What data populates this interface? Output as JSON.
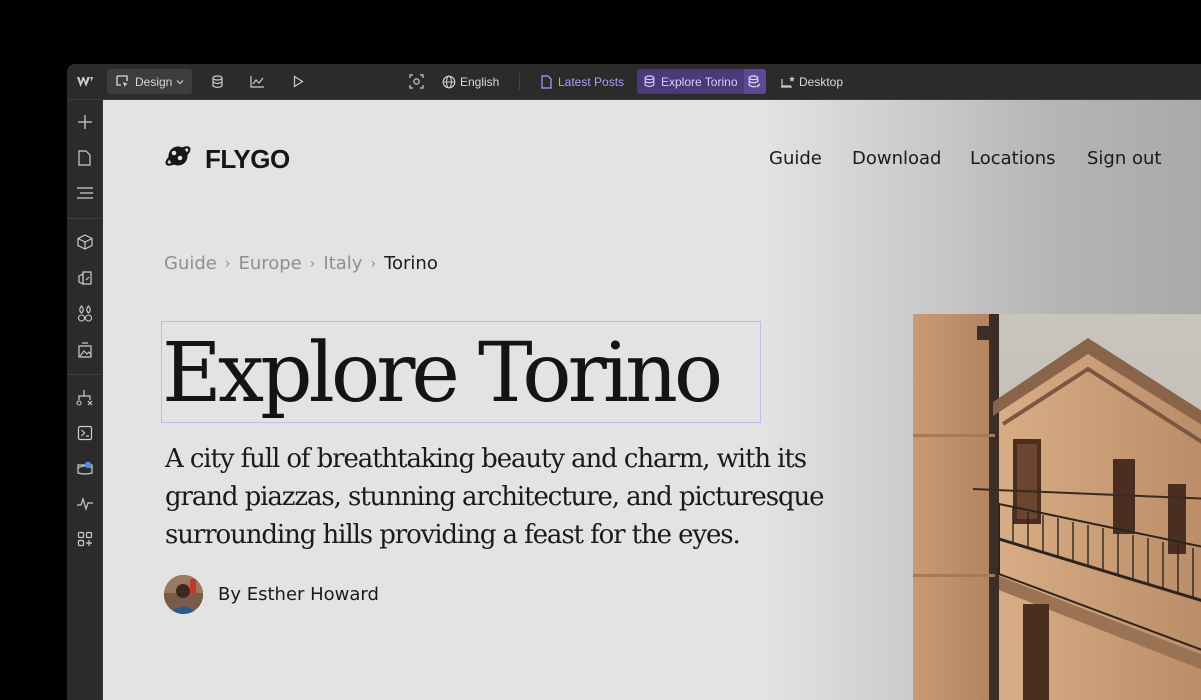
{
  "toolbar": {
    "mode_label": "Design",
    "locale_label": "English",
    "page_label": "Latest Posts",
    "collection_label": "Explore Torino",
    "breakpoint_label": "Desktop"
  },
  "site": {
    "brand": "FLYGO",
    "nav": [
      "Guide",
      "Download",
      "Locations",
      "Sign out"
    ],
    "breadcrumb": [
      "Guide",
      "Europe",
      "Italy",
      "Torino"
    ],
    "title": "Explore Torino",
    "description": "A city full of breathtaking beauty and charm, with its grand piazzas, stunning architecture, and picturesque surrounding hills providing a feast for the eyes.",
    "author": "By Esther Howard"
  },
  "breadcrumb_separator": "›",
  "icons": {
    "toolbar": [
      "webflow-logo-icon",
      "cursor-box-icon",
      "chevron-down-icon",
      "database-icon",
      "chart-icon",
      "play-icon",
      "preview-icon",
      "globe-icon",
      "page-icon",
      "collection-icon",
      "cms-icon",
      "desktop-icon"
    ],
    "sidebar": [
      "plus-icon",
      "pages-icon",
      "navigator-icon",
      "components-icon",
      "variables-icon",
      "style-icon",
      "assets-icon",
      "logic-icon",
      "code-icon",
      "apps-icon",
      "activity-icon",
      "marketplace-icon"
    ]
  },
  "colors": {
    "toolbar_bg": "#2b2b2b",
    "accent_purple": "#b39bff",
    "collection_bg": "#4a3a7a",
    "selection_outline": "#c6b8f0",
    "canvas_bg": "#e3e3e3"
  }
}
